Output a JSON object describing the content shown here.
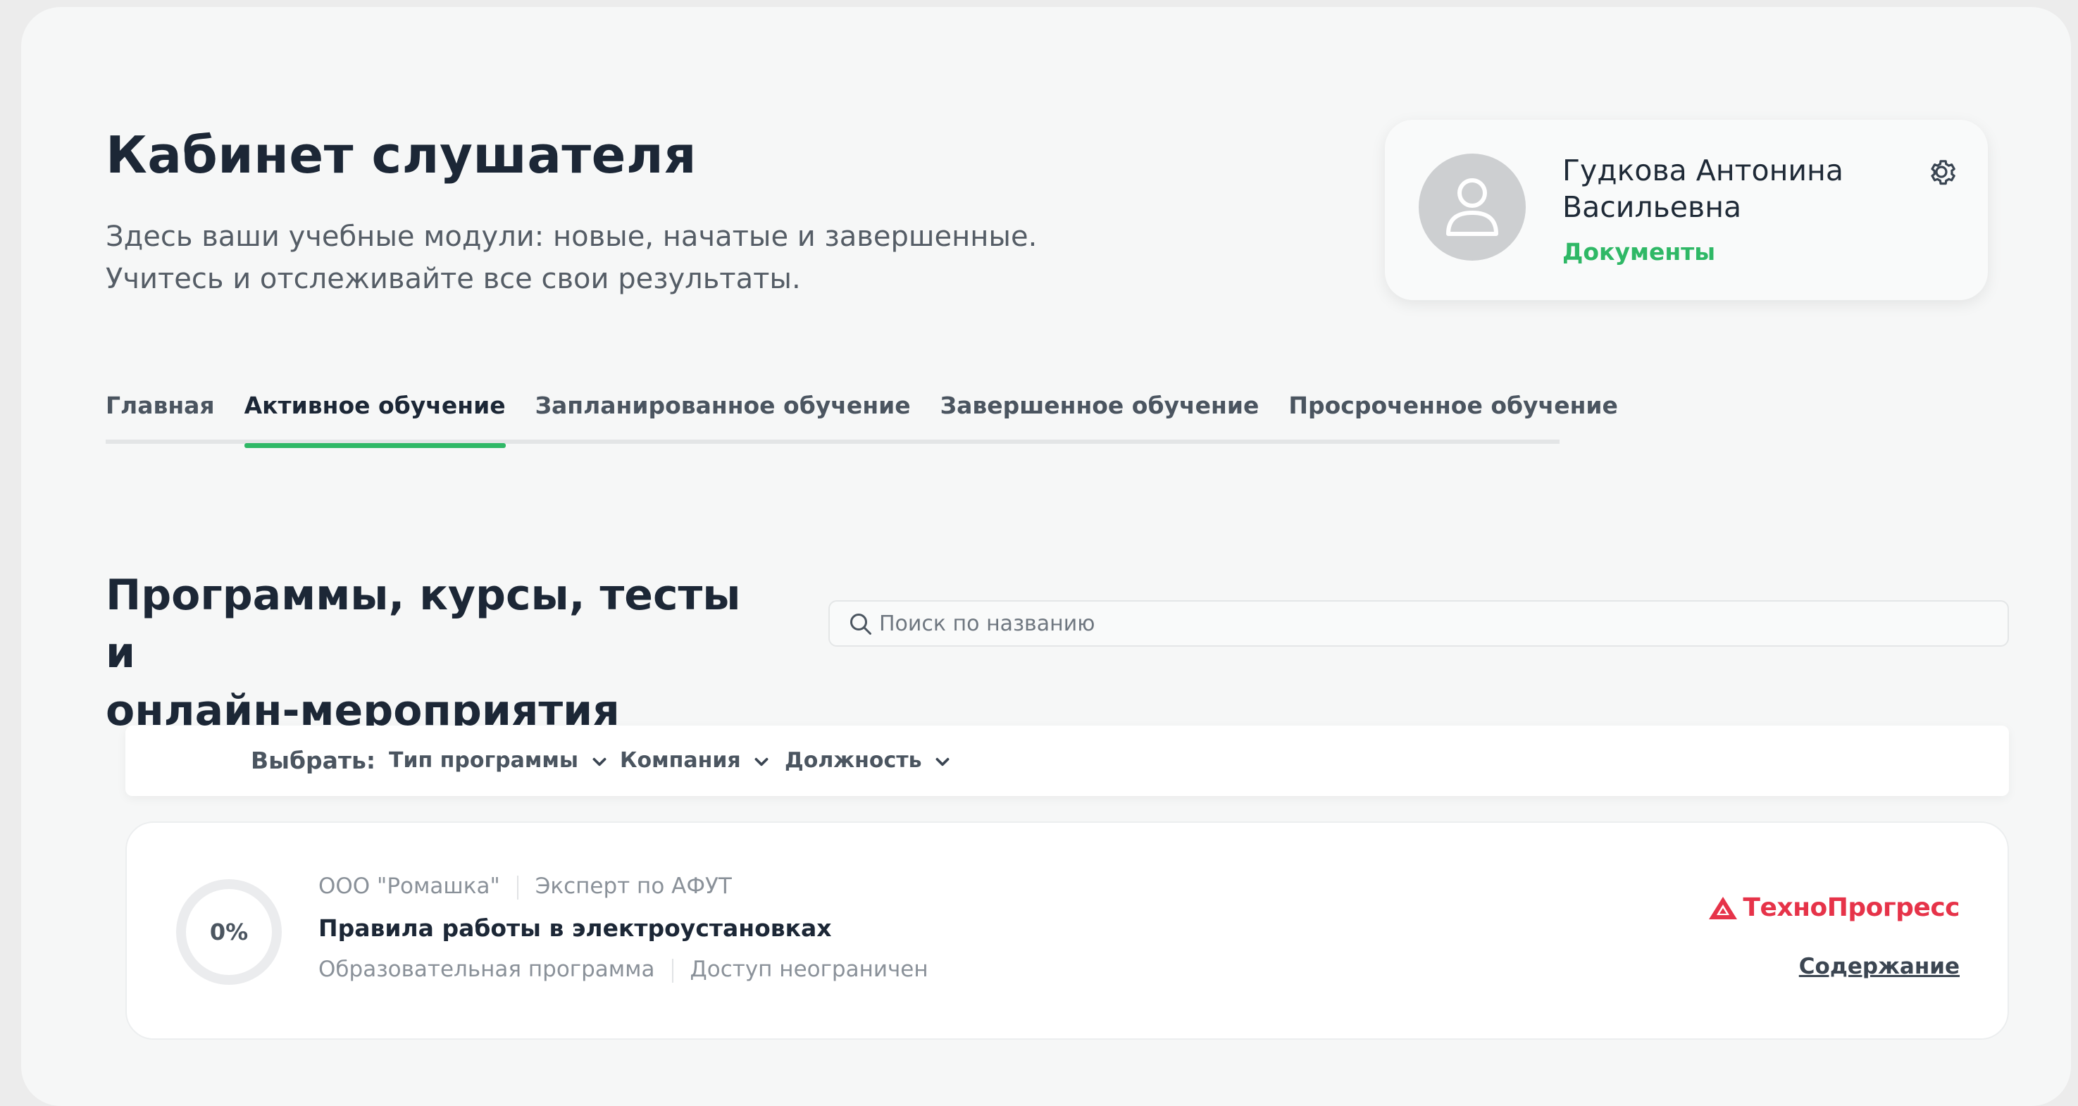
{
  "header": {
    "title": "Кабинет слушателя",
    "subtitle_line1": "Здесь ваши учебные модули: новые, начатые и завершенные.",
    "subtitle_line2": "Учитесь и отслеживайте все свои результаты."
  },
  "profile": {
    "name_line1": "Гудкова Антонина",
    "name_line2": "Васильевна",
    "documents_link": "Документы",
    "avatar_icon": "user-icon",
    "settings_icon": "gear-icon"
  },
  "tabs": [
    {
      "label": "Главная",
      "active": false
    },
    {
      "label": "Активное обучение",
      "active": true
    },
    {
      "label": "Запланированное обучение",
      "active": false
    },
    {
      "label": "Завершенное обучение",
      "active": false
    },
    {
      "label": "Просроченное обучение",
      "active": false
    }
  ],
  "section": {
    "title_line1": "Программы, курсы, тесты и",
    "title_line2": "онлайн-мероприятия"
  },
  "search": {
    "placeholder": "Поиск по названию",
    "value": "",
    "icon": "search-icon"
  },
  "filters": {
    "label": "Выбрать:",
    "items": [
      {
        "label": "Тип программы"
      },
      {
        "label": "Компания"
      },
      {
        "label": "Должность"
      }
    ]
  },
  "courses": [
    {
      "progress_percent": 0,
      "progress_text": "0%",
      "company": "ООО \"Ромашка\"",
      "position": "Эксперт по АФУТ",
      "title": "Правила работы в электроустановках",
      "type": "Образовательная программа",
      "access": "Доступ неограничен",
      "brand": "ТехноПрогресс",
      "content_link": "Содержание"
    }
  ],
  "colors": {
    "accent": "#2fb866",
    "brand": "#e63349",
    "text_dark": "#1c2736"
  }
}
